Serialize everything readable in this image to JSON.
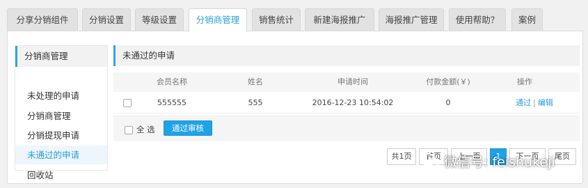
{
  "tabs": [
    {
      "label": "分享分销组件"
    },
    {
      "label": "分销设置"
    },
    {
      "label": "等级设置"
    },
    {
      "label": "分销商管理"
    },
    {
      "label": "销售统计"
    },
    {
      "label": "新建海报推广"
    },
    {
      "label": "海报推广管理"
    },
    {
      "label": "使用帮助？"
    },
    {
      "label": "案例"
    }
  ],
  "active_tab": "分销商管理",
  "sidebar": {
    "title": "分销商管理",
    "items": [
      {
        "label": "未处理的申请"
      },
      {
        "label": "分销商管理"
      },
      {
        "label": "分销提现申请"
      },
      {
        "label": "未通过的申请"
      },
      {
        "label": "回收站"
      }
    ]
  },
  "main": {
    "title": "未通过的申请",
    "columns": [
      "会员名称",
      "姓名",
      "申请时间",
      "付款金额(￥)",
      "操作"
    ],
    "rows": [
      {
        "member": "555555",
        "name": "555",
        "time": "2016-12-23 10:54:02",
        "amount": "0",
        "action_approve": "通过",
        "action_sep": "|",
        "action_edit": "编辑"
      }
    ],
    "select_all_label": "全 选",
    "approve_button": "通过审核"
  },
  "pagination": {
    "total_pages": "共1页",
    "first": "首页",
    "prev": "上一页",
    "current": "1",
    "next": "下一页",
    "last": "尾页"
  },
  "watermark": {
    "text": "微信号: feishukeji"
  },
  "colors": {
    "accent": "#29a8e0",
    "primary_button": "#1fa3e8",
    "link": "#2a9ed8"
  }
}
